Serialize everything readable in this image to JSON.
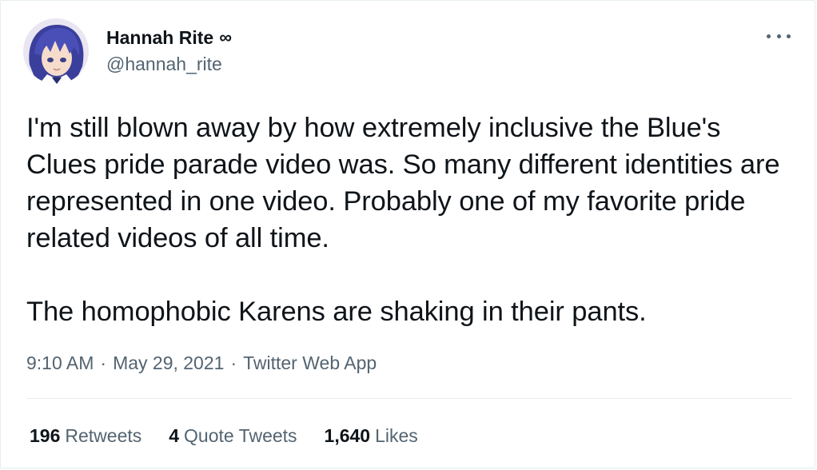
{
  "user": {
    "display_name": "Hannah Rite",
    "name_emoji": "∞",
    "handle": "@hannah_rite",
    "avatar_icon": "anime-avatar"
  },
  "menu": {
    "icon": "more-horizontal-icon"
  },
  "tweet": {
    "paragraph_1": "I'm still blown away by how extremely inclusive the Blue's Clues pride parade video was. So many different identities are represented in one video. Probably one of my favorite pride related videos of all time.",
    "paragraph_2": "The homophobic Karens are shaking in their pants."
  },
  "meta": {
    "time": "9:10 AM",
    "separator": "·",
    "date": "May 29, 2021",
    "source": "Twitter Web App"
  },
  "stats": {
    "retweets_count": "196",
    "retweets_label": "Retweets",
    "quotes_count": "4",
    "quotes_label": "Quote Tweets",
    "likes_count": "1,640",
    "likes_label": "Likes"
  },
  "colors": {
    "text": "#0f1419",
    "secondary": "#536471",
    "border": "#e6ecf0"
  }
}
